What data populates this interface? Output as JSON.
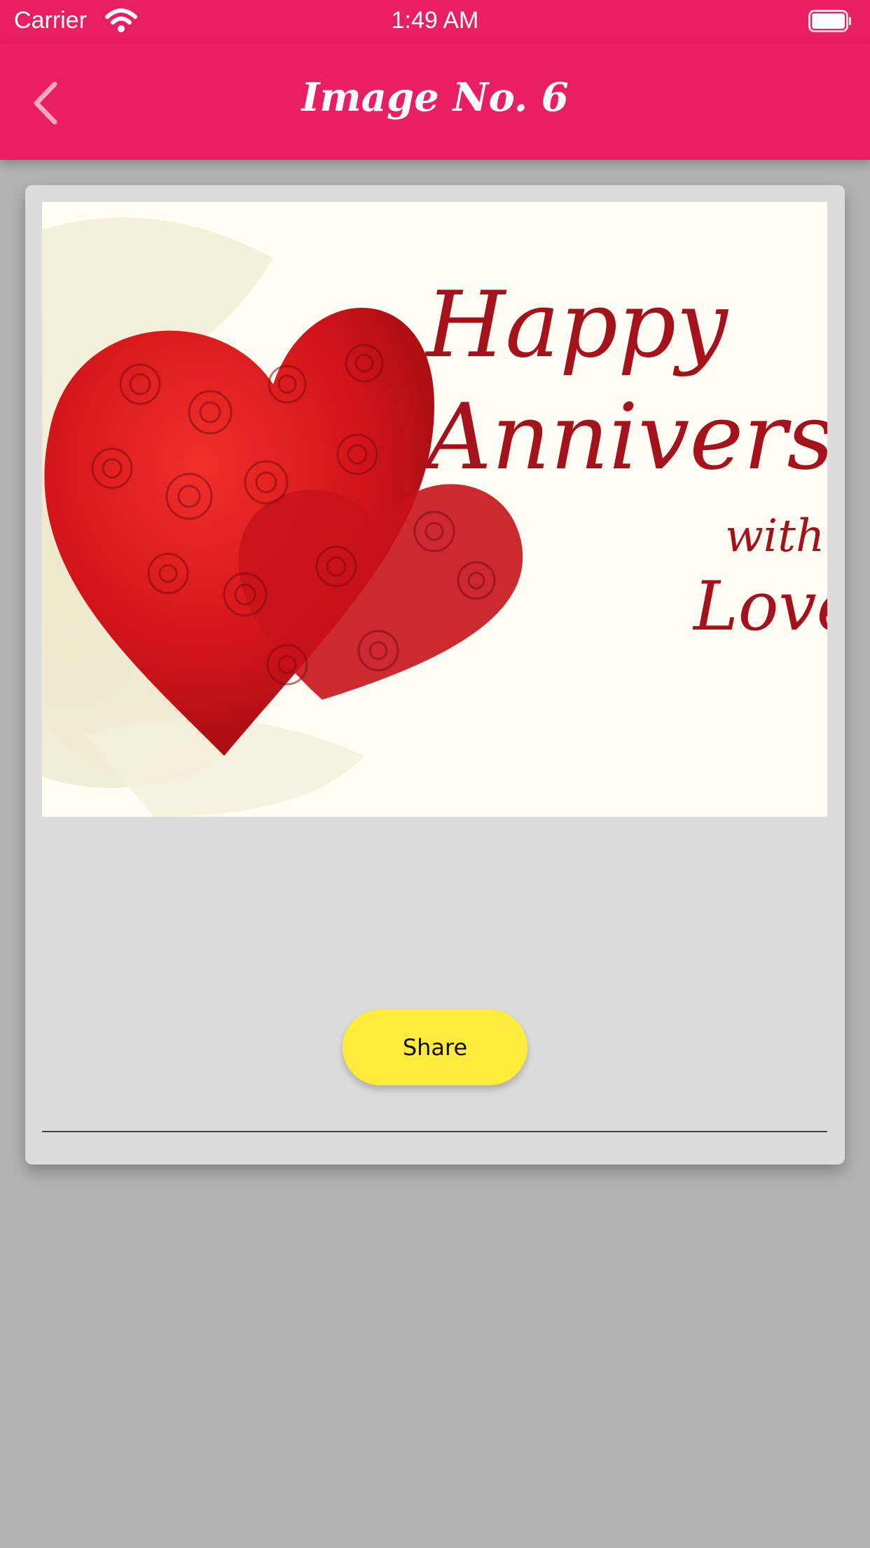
{
  "status_bar": {
    "carrier": "Carrier",
    "time": "1:49 AM"
  },
  "nav": {
    "title": "Image No. 6",
    "back_icon": "chevron-left-icon"
  },
  "image": {
    "text_line1": "Happy",
    "text_line2": "Anniversary",
    "text_line3": "with",
    "text_line4": "Love"
  },
  "actions": {
    "share_label": "Share"
  },
  "colors": {
    "accent": "#e91e63",
    "button": "#ffeb3b",
    "background": "#b3b3b3",
    "card": "#dcdcdc"
  }
}
